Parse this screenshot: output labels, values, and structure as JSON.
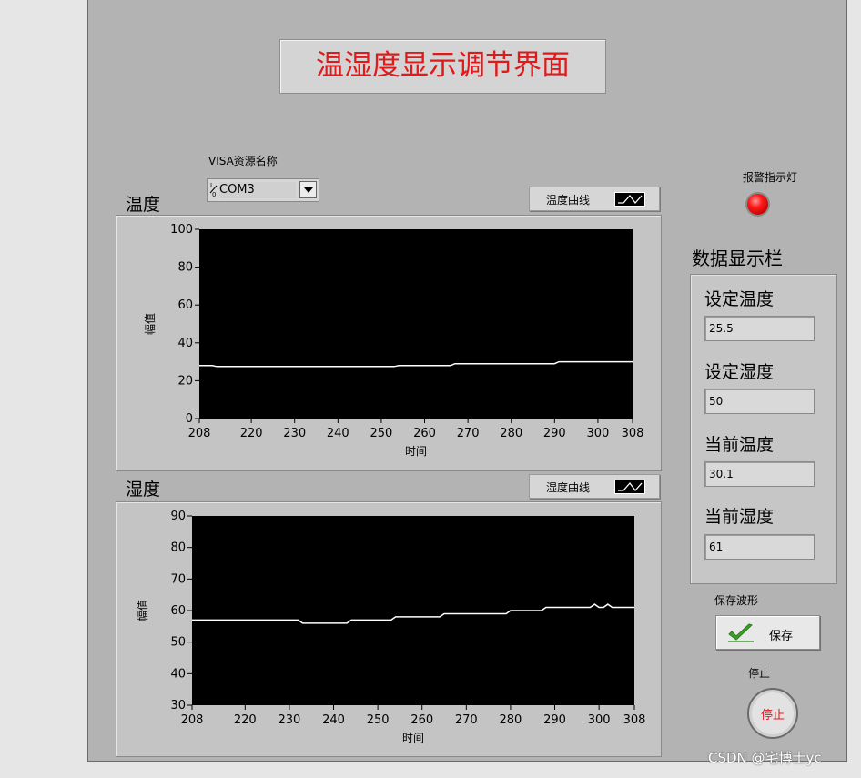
{
  "title": "温湿度显示调节界面",
  "visa": {
    "label": "VISA资源名称",
    "io_icon": "I/O",
    "value": "COM3"
  },
  "temperature_plot": {
    "label": "温度",
    "legend": "温度曲线",
    "xlabel": "时间",
    "ylabel": "幅值"
  },
  "humidity_plot": {
    "label": "湿度",
    "legend": "湿度曲线",
    "xlabel": "时间",
    "ylabel": "幅值"
  },
  "alarm": {
    "label": "报警指示灯",
    "state": "on",
    "color": "#ff1a1a"
  },
  "data_bar": {
    "title": "数据显示栏",
    "fields": [
      {
        "label": "设定温度",
        "value": "25.5"
      },
      {
        "label": "设定湿度",
        "value": "50"
      },
      {
        "label": "当前温度",
        "value": "30.1"
      },
      {
        "label": "当前湿度",
        "value": "61"
      }
    ]
  },
  "save": {
    "section_label": "保存波形",
    "button_label": "保存"
  },
  "stop": {
    "section_label": "停止",
    "button_label": "停止"
  },
  "watermark": "CSDN @宅博士yc",
  "colors": {
    "title_text": "#e0191b",
    "plot_background": "#000000",
    "trace": "#ffffff",
    "panel": "#b3b3b3"
  },
  "icons": {
    "dropdown": "chevron-down-icon",
    "legend": "waveform-icon",
    "save": "checkmark-icon"
  },
  "chart_data": [
    {
      "type": "line",
      "title": "温度",
      "xlabel": "时间",
      "ylabel": "幅值",
      "xlim": [
        208,
        308
      ],
      "ylim": [
        0,
        100
      ],
      "xticks": [
        208,
        220,
        230,
        240,
        250,
        260,
        270,
        280,
        290,
        300,
        308
      ],
      "yticks": [
        0,
        20,
        40,
        60,
        80,
        100
      ],
      "grid": false,
      "series": [
        {
          "name": "温度曲线",
          "x": [
            208,
            211,
            212,
            253,
            254,
            266,
            267,
            290,
            291,
            308
          ],
          "y": [
            28,
            28,
            27.5,
            27.5,
            28,
            28,
            29,
            29,
            30,
            30
          ]
        }
      ]
    },
    {
      "type": "line",
      "title": "湿度",
      "xlabel": "时间",
      "ylabel": "幅值",
      "xlim": [
        208,
        308
      ],
      "ylim": [
        30,
        90
      ],
      "xticks": [
        208,
        220,
        230,
        240,
        250,
        260,
        270,
        280,
        290,
        300,
        308
      ],
      "yticks": [
        30,
        40,
        50,
        60,
        70,
        80,
        90
      ],
      "grid": false,
      "series": [
        {
          "name": "湿度曲线",
          "x": [
            208,
            232,
            233,
            243,
            244,
            253,
            254,
            264,
            265,
            279,
            280,
            287,
            288,
            298,
            299,
            300,
            301,
            302,
            303,
            308
          ],
          "y": [
            57,
            57,
            56,
            56,
            57,
            57,
            58,
            58,
            59,
            59,
            60,
            60,
            61,
            61,
            62,
            61,
            61,
            62,
            61,
            61
          ]
        }
      ]
    }
  ]
}
